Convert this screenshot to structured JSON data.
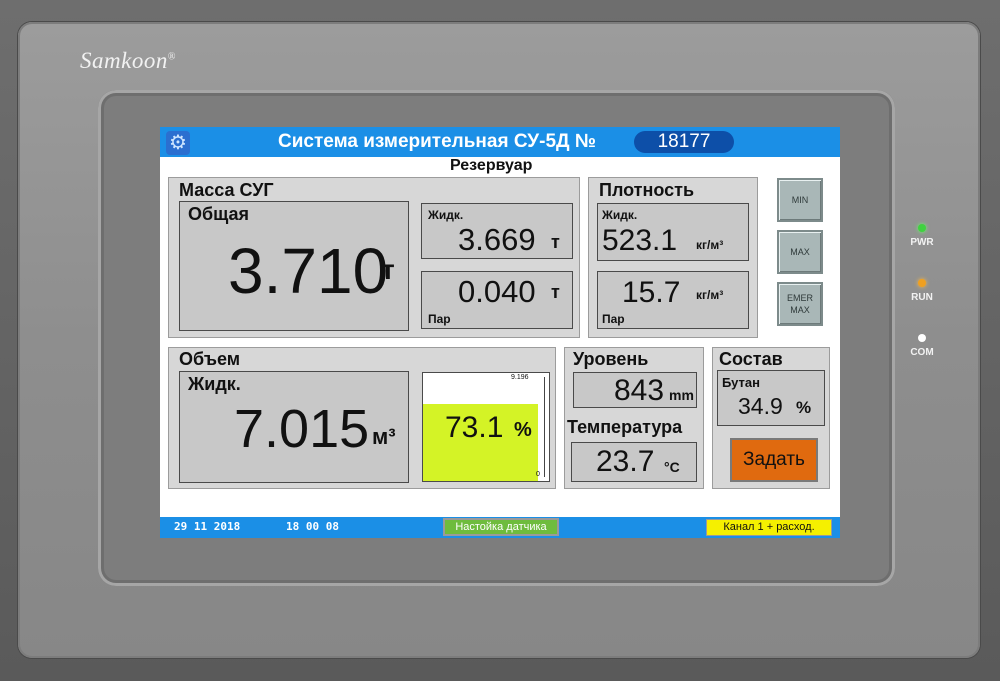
{
  "device": {
    "brand": "Samkoon",
    "brand_mark": "®",
    "leds": [
      {
        "label": "PWR",
        "color": "#3fd23f"
      },
      {
        "label": "RUN",
        "color": "#f0a020"
      },
      {
        "label": "COM",
        "color": "#ffffff"
      }
    ]
  },
  "header": {
    "gear_icon": "gear-icon",
    "title": "Система измерительная СУ-5Д №",
    "serial": "18177",
    "subtitle": "Резервуар"
  },
  "mass": {
    "title": "Масса СУГ",
    "total_label": "Общая",
    "total_value": "3.710",
    "total_unit": "т",
    "liquid_label": "Жидк.",
    "liquid_value": "3.669",
    "liquid_unit": "т",
    "vapor_value": "0.040",
    "vapor_unit": "т",
    "vapor_label": "Пар"
  },
  "density": {
    "title": "Плотность",
    "liquid_label": "Жидк.",
    "liquid_value": "523.1",
    "liquid_unit": "кг/м³",
    "vapor_value": "15.7",
    "vapor_unit": "кг/м³",
    "vapor_label": "Пар"
  },
  "side_buttons": [
    {
      "label": "MIN"
    },
    {
      "label": "MAX"
    },
    {
      "label_line1": "EMER",
      "label_line2": "MAX"
    }
  ],
  "volume": {
    "title": "Объем",
    "liquid_label": "Жидк.",
    "liquid_value": "7.015",
    "liquid_unit": "м³",
    "scale_max": "9.196",
    "scale_min": "0",
    "fill_percent": 73.1,
    "fill_value": "73.1",
    "fill_unit": "%",
    "fill_color": "#d4f326"
  },
  "level": {
    "title": "Уровень",
    "value": "843",
    "unit": "mm"
  },
  "temperature": {
    "title": "Температура",
    "value": "23.7",
    "unit": "°C"
  },
  "composition": {
    "title": "Состав",
    "butane_label": "Бутан",
    "butane_value": "34.9",
    "butane_unit": "%",
    "set_button": "Задать",
    "set_button_color": "#e06a0f"
  },
  "status": {
    "date": "29  11  2018",
    "time": "18 00 08",
    "sensor_setup": "Настойка датчика",
    "channel": "Канал 1 + расход."
  }
}
